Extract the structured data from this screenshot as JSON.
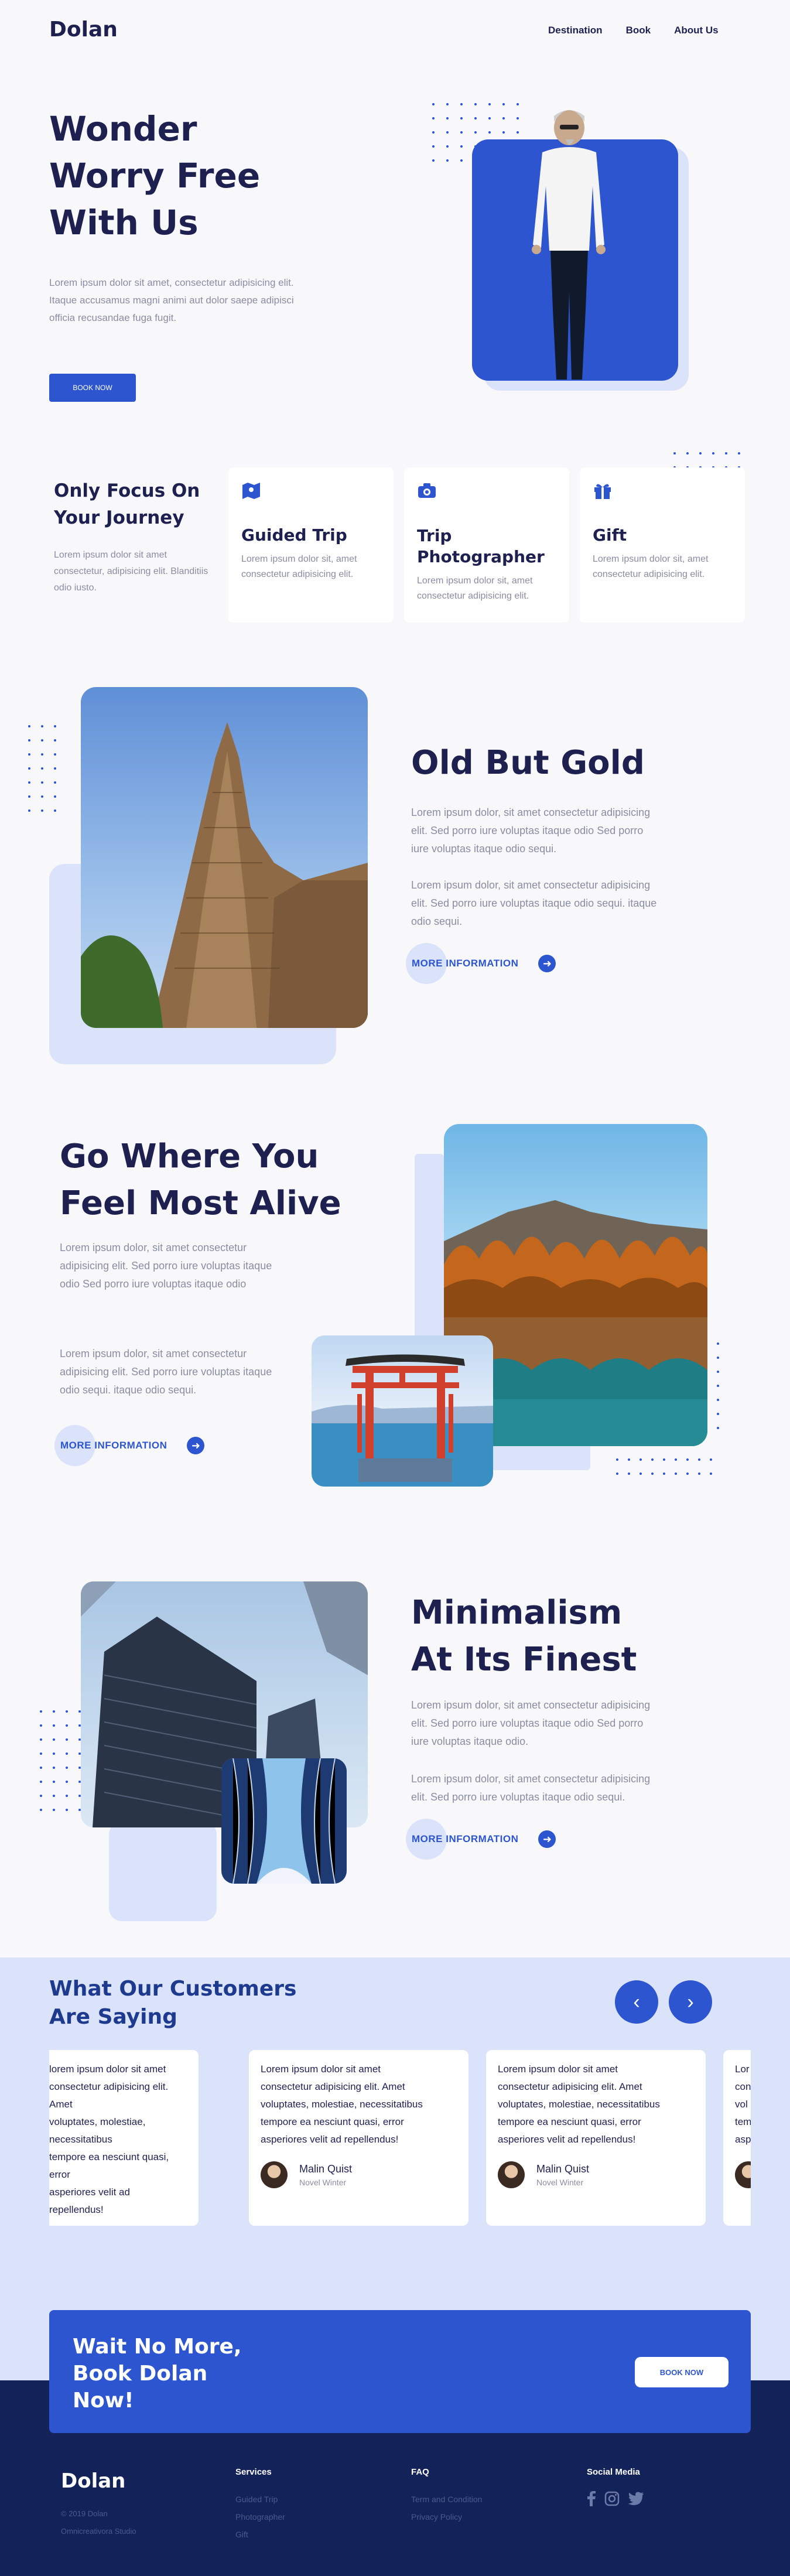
{
  "brand": "Dolan",
  "nav": {
    "items": [
      "Destination",
      "Book",
      "About Us"
    ]
  },
  "hero": {
    "title_lines": [
      "Wonder",
      "Worry Free",
      "With Us"
    ],
    "text": "Lorem ipsum dolor sit amet, consectetur adipisicing elit. Itaque accusamus magni animi aut dolor saepe adipisci officia recusandae fuga fugit.",
    "button": "BOOK NOW"
  },
  "focus": {
    "title_lines": [
      "Only Focus On",
      "Your Journey"
    ],
    "text": "Lorem ipsum dolor sit amet consectetur, adipisicing elit. Blanditiis odio iusto.",
    "cards": [
      {
        "icon": "map-icon",
        "title": "Guided Trip",
        "text": "Lorem ipsum dolor sit, amet consectetur adipisicing elit."
      },
      {
        "icon": "camera-icon",
        "title": "Trip Photographer",
        "text": "Lorem ipsum dolor sit, amet consectetur adipisicing elit."
      },
      {
        "icon": "gift-icon",
        "title": "Gift",
        "text": "Lorem ipsum dolor sit, amet consectetur adipisicing elit."
      }
    ]
  },
  "gold": {
    "title": "Old But Gold",
    "p1": "Lorem ipsum dolor, sit amet consectetur adipisicing elit. Sed porro iure voluptas itaque odio Sed porro iure voluptas itaque odio sequi.",
    "p2": "Lorem ipsum dolor, sit amet consectetur adipisicing elit. Sed porro iure voluptas itaque odio sequi. itaque odio sequi.",
    "more": "MORE INFORMATION"
  },
  "alive": {
    "title_lines": [
      "Go Where You",
      "Feel Most Alive"
    ],
    "p1": "Lorem ipsum dolor, sit amet consectetur adipisicing elit. Sed porro iure voluptas itaque odio Sed porro iure voluptas itaque odio",
    "p2": "Lorem ipsum dolor, sit amet consectetur adipisicing elit. Sed porro iure voluptas itaque odio sequi. itaque odio sequi.",
    "more": "MORE INFORMATION"
  },
  "minimal": {
    "title_lines": [
      "Minimalism",
      "At Its Finest"
    ],
    "p1": "Lorem ipsum dolor, sit amet consectetur adipisicing elit. Sed porro iure voluptas itaque odio Sed porro iure voluptas itaque odio.",
    "p2": "Lorem ipsum dolor, sit amet consectetur adipisicing elit. Sed porro iure voluptas itaque odio sequi.",
    "more": "MORE INFORMATION"
  },
  "testimonials": {
    "title_lines": [
      "What Our Customers",
      "Are Saying"
    ],
    "prev": "‹",
    "next": "›",
    "partial_left": [
      "lorem ipsum dolor sit amet",
      "consectetur adipisicing elit. Amet",
      "voluptates, molestiae, necessitatibus",
      "tempore ea nesciunt quasi, error",
      "asperiores velit ad repellendus!"
    ],
    "text_lines": [
      "Lorem ipsum dolor sit amet",
      "consectetur adipisicing elit. Amet",
      "voluptates, molestiae, necessitatibus",
      "tempore ea nesciunt quasi, error",
      "asperiores velit ad repellendus!"
    ],
    "partial_right": [
      "Lor",
      "con",
      "vol",
      "tem",
      "asp"
    ],
    "name": "Malin Quist",
    "role": "Novel Winter"
  },
  "cta": {
    "title_lines": [
      "Wait No More,",
      "Book Dolan",
      "Now!"
    ],
    "button": "BOOK NOW"
  },
  "footer": {
    "brand": "Dolan",
    "copy": "© 2019 Dolan",
    "studio": "Omnicreativora Studio",
    "services": {
      "title": "Services",
      "links": [
        "Guided Trip",
        "Photographer",
        "Gift"
      ]
    },
    "faq": {
      "title": "FAQ",
      "links": [
        "Term and Condition",
        "Privacy Policy"
      ]
    },
    "social": {
      "title": "Social Media",
      "icons": [
        "facebook-icon",
        "instagram-icon",
        "twitter-icon"
      ]
    }
  },
  "colors": {
    "accent": "#2c55cf",
    "navy": "#1e2150",
    "light_blue": "#dbe3fb",
    "footer_bg": "#13235a"
  }
}
